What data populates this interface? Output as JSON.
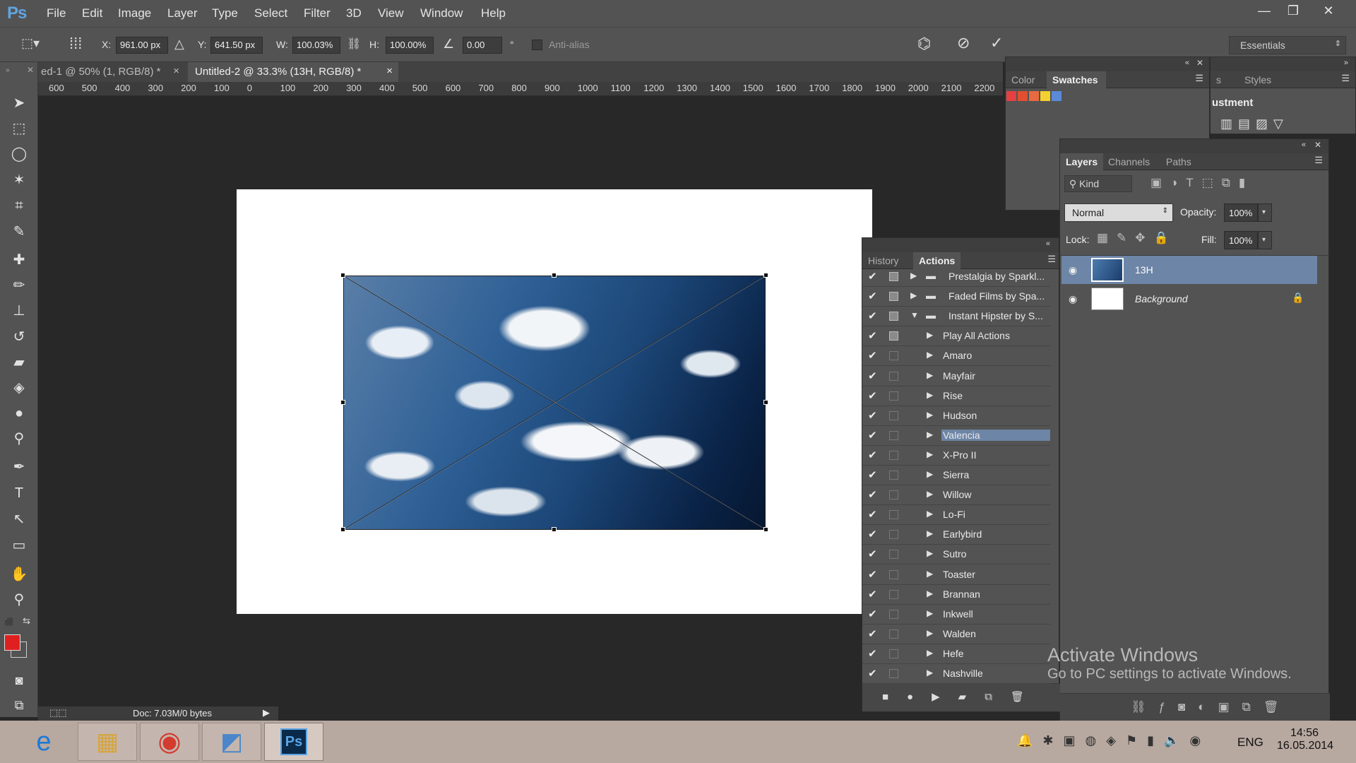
{
  "app": {
    "logo": "Ps"
  },
  "menu": [
    "File",
    "Edit",
    "Image",
    "Layer",
    "Type",
    "Select",
    "Filter",
    "3D",
    "View",
    "Window",
    "Help"
  ],
  "window_controls": {
    "minimize": "—",
    "restore": "❐",
    "close": "✕"
  },
  "options": {
    "x_label": "X:",
    "x_value": "961.00 px",
    "y_label": "Y:",
    "y_value": "641.50 px",
    "w_label": "W:",
    "w_value": "100.03%",
    "h_label": "H:",
    "h_value": "100.00%",
    "angle_value": "0.00",
    "degree": "°",
    "antialias_label": "Anti-alias",
    "workspace": "Essentials"
  },
  "tabs": [
    {
      "label": "ed-1 @ 50% (1, RGB/8) *",
      "close": "×"
    },
    {
      "label": "Untitled-2 @ 33.3% (13H, RGB/8) *",
      "close": "×"
    }
  ],
  "ruler_ticks": [
    "600",
    "500",
    "400",
    "300",
    "200",
    "100",
    "0",
    "100",
    "200",
    "300",
    "400",
    "500",
    "600",
    "700",
    "800",
    "900",
    "1000",
    "1100",
    "1200",
    "1300",
    "1400",
    "1500",
    "1600",
    "1700",
    "1800",
    "1900",
    "2000",
    "2100",
    "2200"
  ],
  "colors": {
    "foreground": "#e02020",
    "background": "#000000",
    "selection": "#6d85a6"
  },
  "swatches_panel": {
    "tabs": [
      "Color",
      "Swatches"
    ],
    "active_tab": "Swatches",
    "swatches": [
      "#e64040",
      "#e05030",
      "#e86a40",
      "#f2d030",
      "#5a8ad8"
    ]
  },
  "adjustments_panel": {
    "tabs": [
      "s",
      "Styles"
    ],
    "title": "ustment"
  },
  "actions_panel": {
    "tabs": [
      "History",
      "Actions"
    ],
    "active_tab": "Actions",
    "sets": [
      {
        "label": "Prestalgia by Sparkl...",
        "expanded": false
      },
      {
        "label": "Faded Films by Spa...",
        "expanded": false
      },
      {
        "label": "Instant Hipster by S...",
        "expanded": true
      }
    ],
    "actions": [
      "Play All Actions",
      "Amaro",
      "Mayfair",
      "Rise",
      "Hudson",
      "Valencia",
      "X-Pro II",
      "Sierra",
      "Willow",
      "Lo-Fi",
      "Earlybird",
      "Sutro",
      "Toaster",
      "Brannan",
      "Inkwell",
      "Walden",
      "Hefe",
      "Nashville"
    ],
    "selected": "Valencia"
  },
  "layers_panel": {
    "tabs": [
      "Layers",
      "Channels",
      "Paths"
    ],
    "active_tab": "Layers",
    "filter_label": "Kind",
    "blend_mode": "Normal",
    "opacity_label": "Opacity:",
    "opacity_value": "100%",
    "lock_label": "Lock:",
    "fill_label": "Fill:",
    "fill_value": "100%",
    "layers": [
      {
        "name": "13H",
        "selected": true
      },
      {
        "name": "Background",
        "selected": false,
        "locked": true
      }
    ]
  },
  "status_bar": {
    "doc": "Doc: 7.03M/0 bytes"
  },
  "watermark": {
    "title": "Activate Windows",
    "subtitle": "Go to PC settings to activate Windows."
  },
  "taskbar": {
    "language": "ENG",
    "time": "14:56",
    "date": "16.05.2014"
  }
}
